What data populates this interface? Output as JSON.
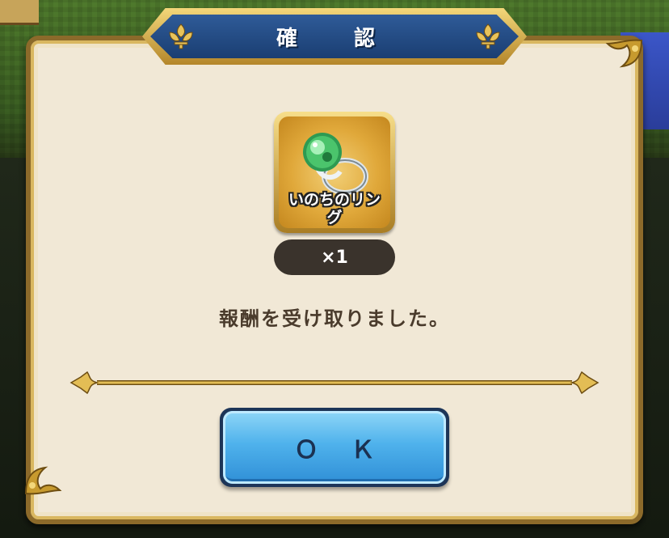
{
  "dialog": {
    "title": "確　認",
    "item": {
      "name": "いのちのリング",
      "icon": "ring-icon",
      "quantity": "×1"
    },
    "message": "報酬を受け取りました。",
    "ok_label": "ＯＫ"
  },
  "colors": {
    "title_bar": "#1a3e72",
    "panel": "#f1e8d6",
    "gold": "#c79a2e",
    "button": "#4fb2ec",
    "message_text": "#4a3b2c"
  }
}
